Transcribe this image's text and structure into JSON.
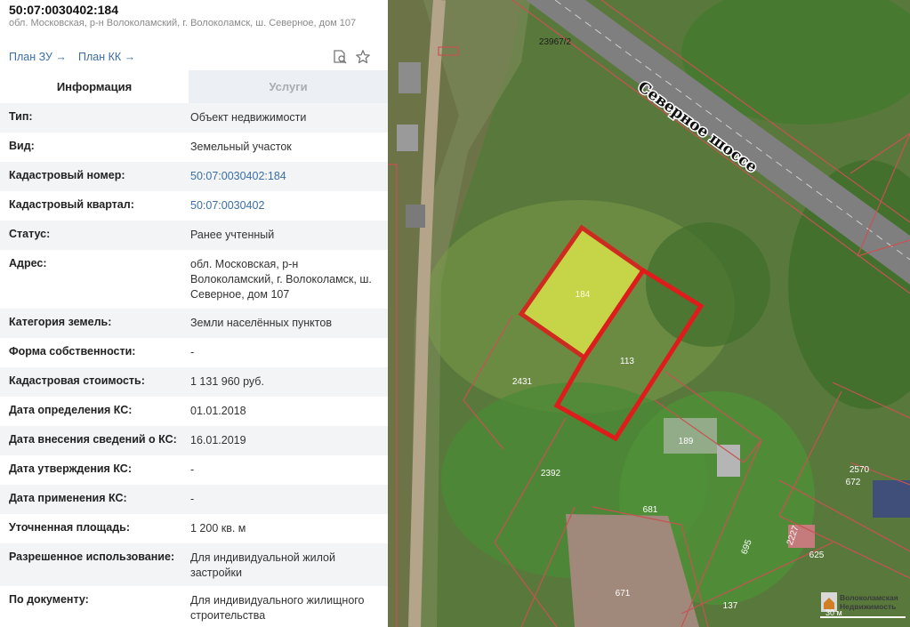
{
  "header": {
    "cadastral_number": "50:07:0030402:184",
    "address": "обл. Московская, р-н Волоколамский, г. Волоколамск, ш. Северное, дом 107",
    "plan_zu": "План ЗУ →",
    "plan_kk": "План КК →"
  },
  "tabs": [
    {
      "label": "Информация"
    },
    {
      "label": "Услуги"
    }
  ],
  "rows": [
    {
      "key": "Тип:",
      "value": "Объект недвижимости"
    },
    {
      "key": "Вид:",
      "value": "Земельный участок"
    },
    {
      "key": "Кадастровый номер:",
      "value": "50:07:0030402:184"
    },
    {
      "key": "Кадастровый квартал:",
      "value": "50:07:0030402"
    },
    {
      "key": "Статус:",
      "value": "Ранее учтенный"
    },
    {
      "key": "Адрес:",
      "value": "обл. Московская, р-н Волоколамский, г. Волоколамск, ш. Северное, дом 107"
    },
    {
      "key": "Категория земель:",
      "value": "Земли населённых пунктов"
    },
    {
      "key": "Форма собственности:",
      "value": "-"
    },
    {
      "key": "Кадастровая стоимость:",
      "value": "1 131 960 руб."
    },
    {
      "key": "Дата определения КС:",
      "value": "01.01.2018"
    },
    {
      "key": "Дата внесения сведений о КС:",
      "value": "16.01.2019"
    },
    {
      "key": "Дата утверждения КС:",
      "value": "-"
    },
    {
      "key": "Дата применения КС:",
      "value": "-"
    },
    {
      "key": "Уточненная площадь:",
      "value": "1 200 кв. м"
    },
    {
      "key": "Разрешенное использование:",
      "value": "Для индивидуальной жилой застройки"
    },
    {
      "key": "По документу:",
      "value": "Для индивидуального жилищного строительства"
    }
  ],
  "icons": {
    "search": "search-document-icon",
    "favorite": "star-icon",
    "watermark_logo": "house-logo-icon"
  },
  "map": {
    "road_name": "Северное шоссе",
    "road_label_top": "23967/2",
    "parcels": {
      "p184": "184",
      "p113": "113",
      "p2431": "2431",
      "p2392": "2392",
      "p681": "681",
      "p189": "189",
      "p671": "671",
      "p2570": "2570",
      "p672": "672",
      "p2227": "2227",
      "p625": "625",
      "p695": "695",
      "p137": "137"
    },
    "watermark": [
      "Волоколамская",
      "Недвижимость"
    ],
    "scale": "30 м"
  },
  "colors": {
    "link": "#3a6ea5",
    "parcel_highlight": "#e01b1b",
    "parcel_fill": "#d7e34a",
    "boundary": "#c75252"
  }
}
